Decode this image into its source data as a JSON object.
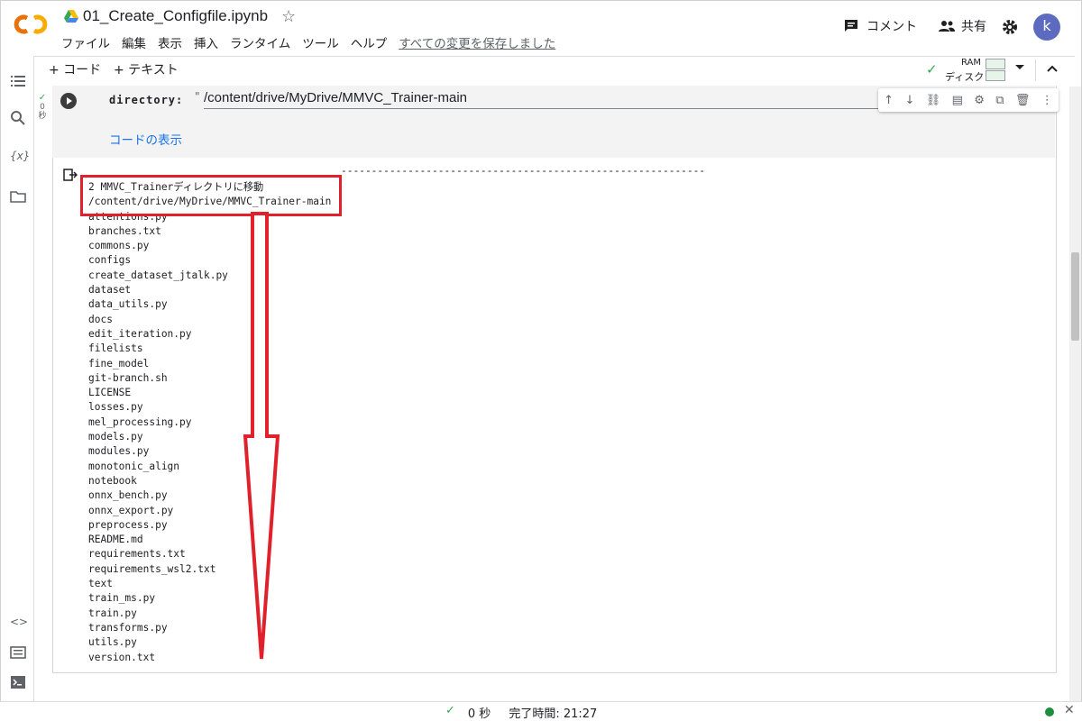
{
  "header": {
    "title": "01_Create_Configfile.ipynb",
    "menus": [
      "ファイル",
      "編集",
      "表示",
      "挿入",
      "ランタイム",
      "ツール",
      "ヘルプ"
    ],
    "saved_status": "すべての変更を保存しました",
    "comment_label": "コメント",
    "share_label": "共有",
    "avatar_letter": "k"
  },
  "toolbar": {
    "add_code": "+ コード",
    "add_text": "+ テキスト",
    "ram_label": "RAM",
    "disk_label": "ディスク"
  },
  "cell": {
    "exec_time": "0",
    "exec_unit": "秒",
    "param_label": "directory:",
    "param_value": "/content/drive/MyDrive/MMVC_Trainer-main",
    "show_code": "コードの表示"
  },
  "output": {
    "separator": "------------------------------------------------------------",
    "lines": [
      "2 MMVC_Trainerディレクトリに移動",
      "/content/drive/MyDrive/MMVC_Trainer-main",
      "attentions.py",
      "branches.txt",
      "commons.py",
      "configs",
      "create_dataset_jtalk.py",
      "dataset",
      "data_utils.py",
      "docs",
      "edit_iteration.py",
      "filelists",
      "fine_model",
      "git-branch.sh",
      "LICENSE",
      "losses.py",
      "mel_processing.py",
      "models.py",
      "modules.py",
      "monotonic_align",
      "notebook",
      "onnx_bench.py",
      "onnx_export.py",
      "preprocess.py",
      "README.md",
      "requirements.txt",
      "requirements_wsl2.txt",
      "text",
      "train_ms.py",
      "train.py",
      "transforms.py",
      "utils.py",
      "version.txt"
    ]
  },
  "status": {
    "check": "✓",
    "elapsed": "0 秒",
    "completed": "完了時間: 21:27"
  },
  "colors": {
    "highlight": "#e0212c",
    "link": "#1a73e8",
    "avatar": "#5c6bc0"
  }
}
